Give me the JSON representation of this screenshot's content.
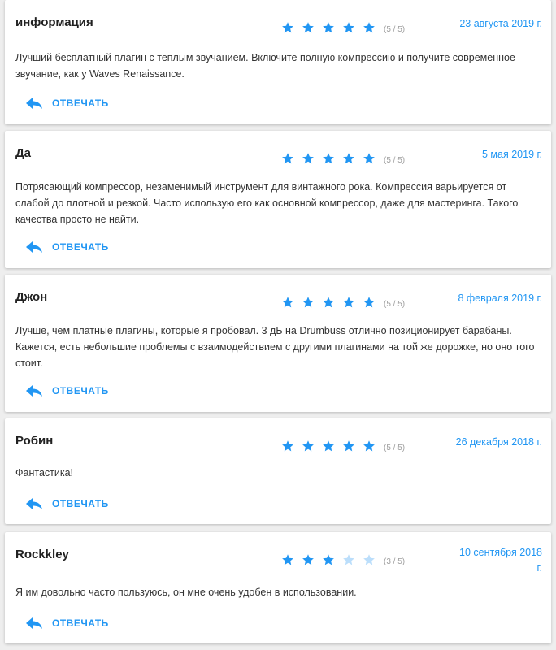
{
  "colors": {
    "accent": "#2196f3",
    "star_filled": "#2196f3",
    "star_empty": "#bbdefb",
    "background": "#eeeeee",
    "card": "#ffffff"
  },
  "reviews": [
    {
      "author": "информация",
      "rating": 5,
      "rating_label": "(5 / 5)",
      "date": "23 августа 2019 г.",
      "text": "Лучший бесплатный плагин с теплым звучанием. Включите полную компрессию и получите современное звучание, как у Waves Renaissance.",
      "reply_label": "ОТВЕЧАТЬ",
      "reply_icon": "reply-icon"
    },
    {
      "author": "Да",
      "rating": 5,
      "rating_label": "(5 / 5)",
      "date": "5 мая 2019 г.",
      "text": "Потрясающий компрессор, незаменимый инструмент для винтажного рока. Компрессия варьируется от слабой до плотной и резкой. Часто использую его как основной компрессор, даже для мастеринга. Такого качества просто не найти.",
      "reply_label": "ОТВЕЧАТЬ",
      "reply_icon": "reply-icon"
    },
    {
      "author": "Джон",
      "rating": 5,
      "rating_label": "(5 / 5)",
      "date": "8 февраля 2019 г.",
      "text": "Лучше, чем платные плагины, которые я пробовал. 3 дБ на Drumbuss отлично позиционирует барабаны. Кажется, есть небольшие проблемы с взаимодействием с другими плагинами на той же дорожке, но оно того стоит.",
      "reply_label": "ОТВЕЧАТЬ",
      "reply_icon": "reply-icon"
    },
    {
      "author": "Робин",
      "rating": 5,
      "rating_label": "(5 / 5)",
      "date": "26 декабря 2018 г.",
      "text": "Фантастика!",
      "reply_label": "ОТВЕЧАТЬ",
      "reply_icon": "reply-icon"
    },
    {
      "author": "Rockkley",
      "rating": 3,
      "rating_label": "(3 / 5)",
      "date": "10 сентября 2018 г.",
      "text": "Я им довольно часто пользуюсь, он мне очень удобен в использовании.",
      "reply_label": "ОТВЕЧАТЬ",
      "reply_icon": "reply-icon"
    }
  ]
}
